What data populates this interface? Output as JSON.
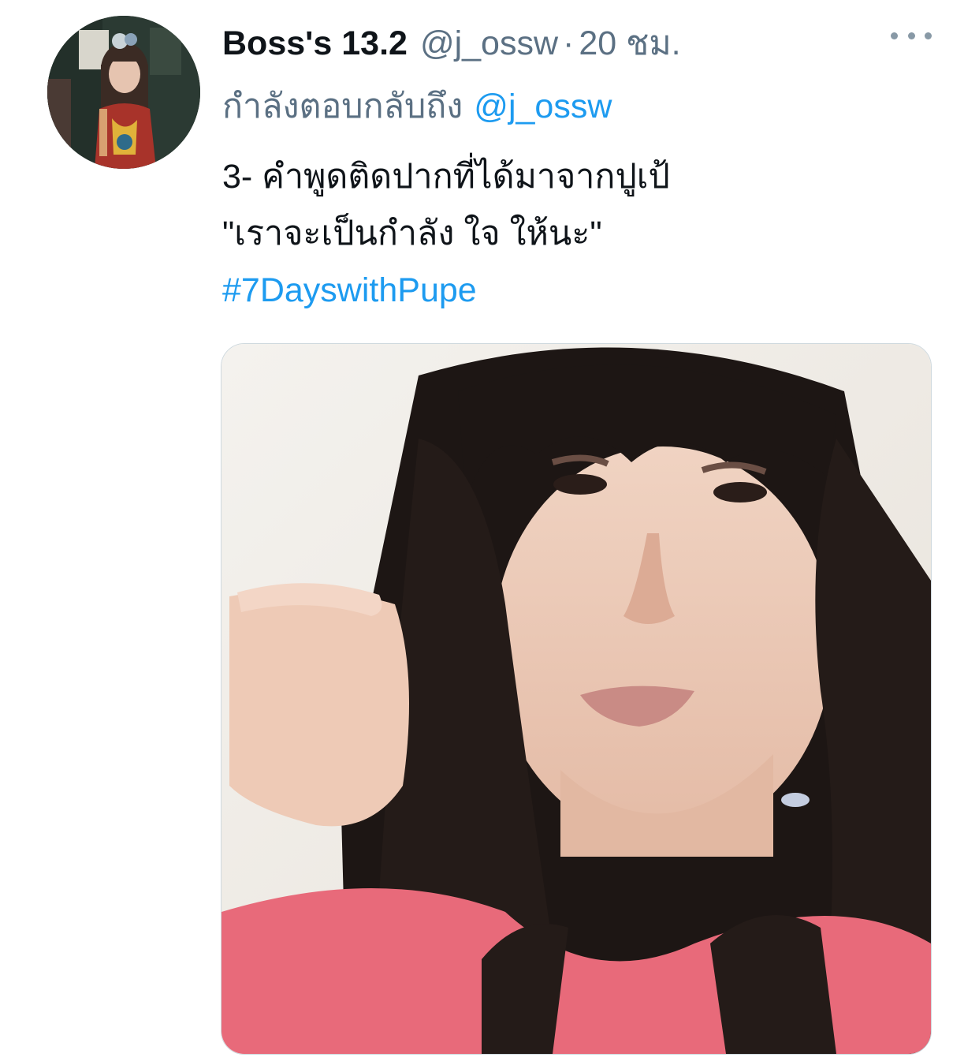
{
  "tweet": {
    "display_name": "Boss's 13.2",
    "handle": "@j_ossw",
    "separator": "·",
    "timestamp": "20 ชม.",
    "reply_prefix": "กำลังตอบกลับถึง",
    "reply_mention": "@j_ossw",
    "text_lines": [
      "3- คำพูดติดปากที่ได้มาจากปูเป้",
      "\"เราจะเป็นกำลัง ใจ ให้นะ\""
    ],
    "hashtag": "#7DayswithPupe"
  },
  "icons": {
    "more": "more-options-icon"
  },
  "colors": {
    "link": "#1d9bf0",
    "secondary_text": "#5b7083",
    "primary_text": "#0f1419"
  }
}
